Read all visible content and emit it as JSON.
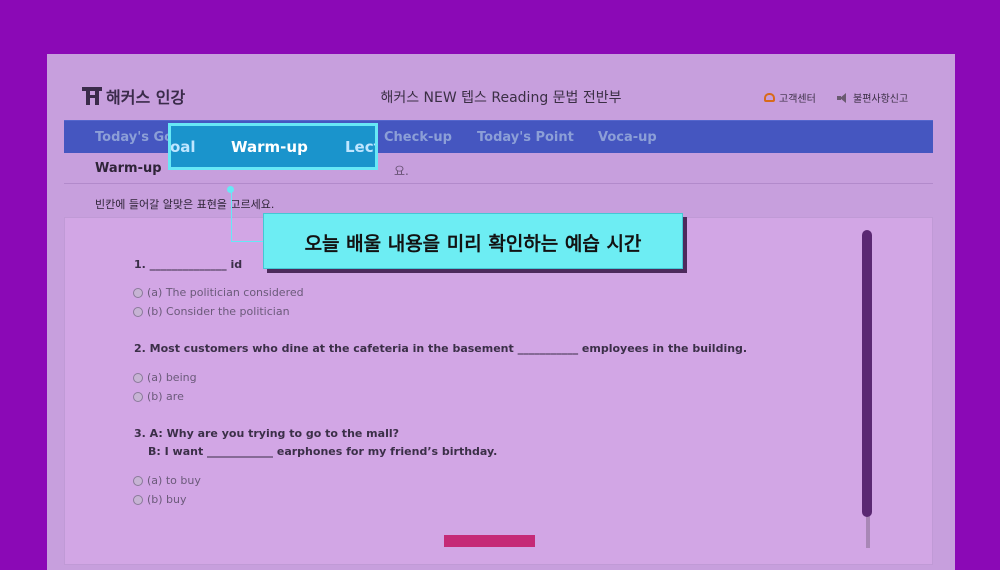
{
  "header": {
    "logo_text": "해커스 인강",
    "course_title": "해커스 NEW 텝스 Reading 문법 전반부",
    "support_label": "고객센터",
    "report_label": "불편사항신고"
  },
  "nav": {
    "items": [
      "Today's Go",
      "Check-up",
      "Today's Point",
      "Voca-up"
    ]
  },
  "callout_tab": {
    "left_fragment": "oal",
    "active_label": "Warm-up",
    "right_fragment": "Lect"
  },
  "subbar": {
    "title": "Warm-up",
    "desc_fragment": "요."
  },
  "instruction": "빈칸에 들어갈 알맞은 표현을 고르세요.",
  "questions": [
    {
      "line1": "1. ______________ id",
      "options": [
        "(a) The politician considered",
        "(b) Consider the politician"
      ]
    },
    {
      "line1": "2. Most customers who dine at the cafeteria in the basement ___________ employees in the building.",
      "options": [
        "(a) being",
        "(b) are"
      ]
    },
    {
      "line1": "3. A: Why are you trying to go to the mall?",
      "line2": "B: I want ____________ earphones for my friend’s birthday.",
      "options": [
        "(a) to buy",
        "(b) buy"
      ]
    }
  ],
  "callout_text": "오늘 배울 내용을 미리 확인하는 예습 시간",
  "colors": {
    "background": "#8b09b6",
    "nav": "#4556c0",
    "callout": "#6dedf3",
    "active_tab": "#1a94cc",
    "next_button": "#c52a77"
  },
  "icons": [
    "phone-icon",
    "speaker-icon"
  ]
}
